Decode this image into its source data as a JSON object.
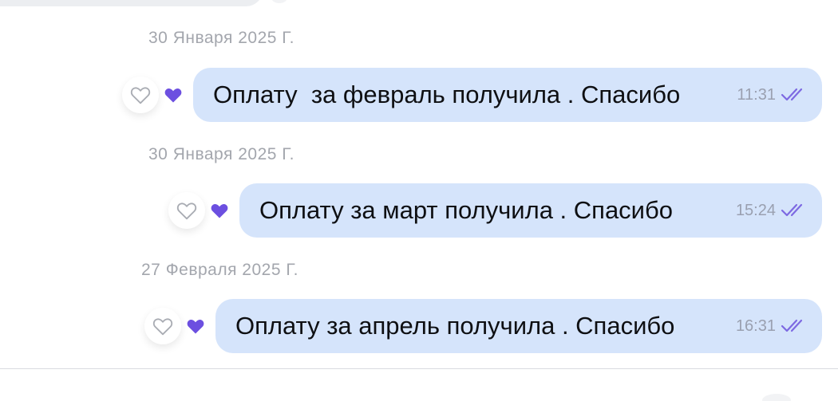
{
  "colors": {
    "bubble": "#d5e4fb",
    "accent": "#6c4fe0",
    "date_text": "#a3a6ad",
    "time_text": "#9aa0b0"
  },
  "messages": [
    {
      "date": "30 Января 2025 Г.",
      "text": "Оплату  за февраль получила . Спасибо",
      "time": "11:31",
      "status_icon": "double-check-icon",
      "reaction_icons": [
        "heart-outline-icon",
        "heart-filled-icon"
      ]
    },
    {
      "date": "30 Января 2025 Г.",
      "text": "Оплату за март получила . Спасибо",
      "time": "15:24",
      "status_icon": "double-check-icon",
      "reaction_icons": [
        "heart-outline-icon",
        "heart-filled-icon"
      ]
    },
    {
      "date": "27 Февраля 2025 Г.",
      "text": "Оплату за апрель получила . Спасибо",
      "time": "16:31",
      "status_icon": "double-check-icon",
      "reaction_icons": [
        "heart-outline-icon",
        "heart-filled-icon"
      ]
    }
  ]
}
